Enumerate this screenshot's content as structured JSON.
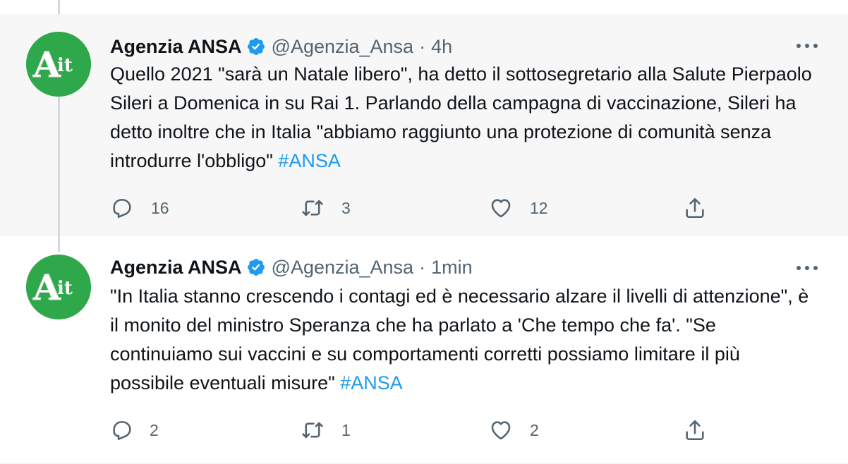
{
  "tweets": [
    {
      "author_name": "Agenzia ANSA",
      "handle": "@Agenzia_Ansa",
      "separator": "·",
      "time": "4h",
      "avatar_text": "Ait",
      "text": "Quello 2021 \"sarà un Natale libero\", ha detto il sottosegretario alla Salute Pierpaolo Sileri a Domenica in su Rai 1. Parlando della campagna di vaccinazione, Sileri ha detto inoltre che in Italia \"abbiamo raggiunto una protezione di comunità senza introdurre l'obbligo\"",
      "hashtag": "#ANSA",
      "replies": "16",
      "retweets": "3",
      "likes": "12"
    },
    {
      "author_name": "Agenzia ANSA",
      "handle": "@Agenzia_Ansa",
      "separator": "·",
      "time": "1min",
      "avatar_text": "Ait",
      "text": "\"In Italia stanno crescendo i contagi ed è necessario alzare il livelli di attenzione\", è il monito del ministro Speranza che ha parlato a 'Che tempo che fa'. \"Se continuiamo sui vaccini e su comportamenti corretti possiamo limitare il più possibile eventuali misure\"",
      "hashtag": "#ANSA",
      "replies": "2",
      "retweets": "1",
      "likes": "2"
    }
  ],
  "colors": {
    "accent": "#1d9bf0",
    "secondary_text": "#536471",
    "avatar_green": "#2ea84a",
    "highlight_bg": "#f7f7f7"
  },
  "icons": [
    "reply-icon",
    "retweet-icon",
    "like-icon",
    "share-icon",
    "more-icon",
    "verified-badge-icon"
  ]
}
